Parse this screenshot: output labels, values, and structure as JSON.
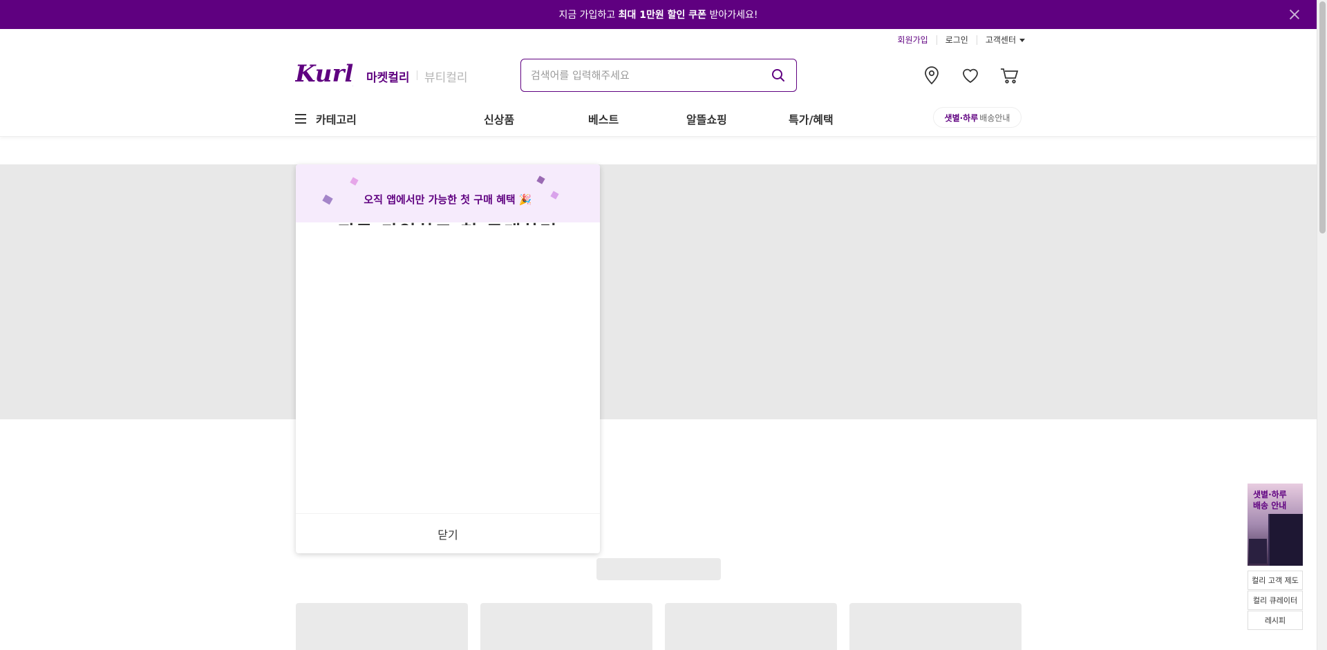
{
  "promo": {
    "text_before": "지금 가입하고 ",
    "text_bold": "최대 1만원 할인 쿠폰",
    "text_after": " 받아가세요!"
  },
  "util_links": {
    "signup": "회원가입",
    "login": "로그인",
    "customer_center": "고객센터"
  },
  "header": {
    "logo_text": "Kurly",
    "tab_market": "마켓컬리",
    "tab_beauty": "뷰티컬리",
    "search_placeholder": "검색어를 입력해주세요"
  },
  "nav": {
    "category": "카테고리",
    "items": [
      "신상품",
      "베스트",
      "알뜰쇼핑",
      "특가/혜택"
    ],
    "delivery_bold": "샛별·하루",
    "delivery_rest": "배송안내"
  },
  "popup": {
    "head": "오직 앱에서만 가능한 첫 구매 혜택 🎉",
    "cut_text": "지금 가입하고 첫 구매하면",
    "close": "닫기"
  },
  "floating": {
    "banner_line1": "샛별·하루",
    "banner_line2": "배송 안내",
    "links": [
      "컬리 고객 제도",
      "컬리 큐레이터",
      "레시피"
    ]
  },
  "colors": {
    "brand": "#5f0080",
    "popup_head_bg": "#f6ebfc",
    "banner_gray": "#e8e8e8"
  }
}
